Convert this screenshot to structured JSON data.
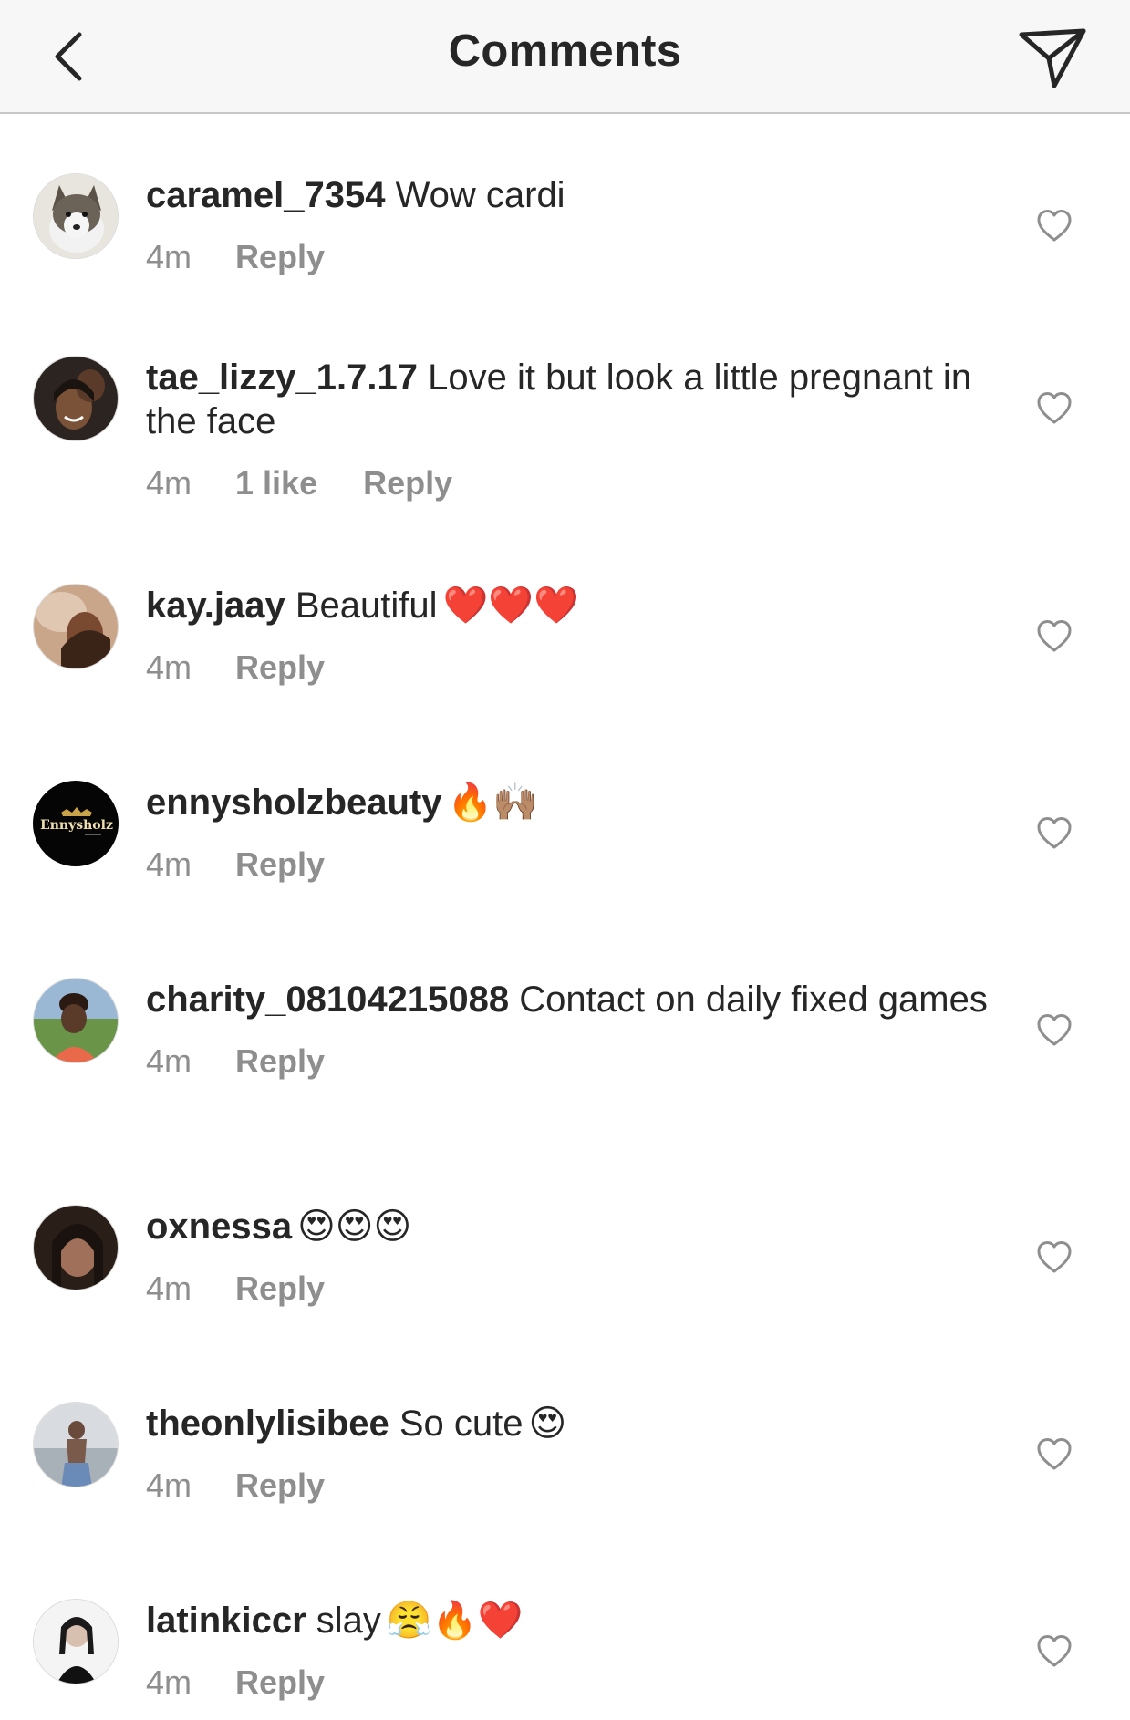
{
  "header": {
    "title": "Comments"
  },
  "icons": {
    "back": "chevron-left-icon",
    "share": "paper-plane-icon",
    "like": "heart-outline-icon"
  },
  "colors": {
    "text": "#262626",
    "meta": "#8e8e8e",
    "header_bg": "#f7f7f7",
    "divider": "#c8c8c8",
    "heart_red": "#e0283a"
  },
  "comments": [
    {
      "username": "caramel_7354",
      "text": "Wow cardi",
      "emoji": "",
      "time": "4m",
      "likes": "",
      "reply": "Reply"
    },
    {
      "username": "tae_lizzy_1.7.17",
      "text": "Love it but look a little pregnant in the face",
      "emoji": "",
      "time": "4m",
      "likes": "1 like",
      "reply": "Reply"
    },
    {
      "username": "kay.jaay",
      "text": "Beautiful",
      "emoji": "❤️❤️❤️",
      "time": "4m",
      "likes": "",
      "reply": "Reply"
    },
    {
      "username": "ennysholzbeauty",
      "text": "",
      "emoji": "🔥🙌🏽",
      "time": "4m",
      "likes": "",
      "reply": "Reply",
      "avatar_text": "Ennysholz"
    },
    {
      "username": "charity_08104215088",
      "text": "Contact on daily fixed games",
      "emoji": "",
      "time": "4m",
      "likes": "",
      "reply": "Reply"
    },
    {
      "username": "oxnessa",
      "text": "",
      "emoji": "😍😍😍",
      "time": "4m",
      "likes": "",
      "reply": "Reply"
    },
    {
      "username": "theonlylisibee",
      "text": "So cute",
      "emoji": "😍",
      "time": "4m",
      "likes": "",
      "reply": "Reply"
    },
    {
      "username": "latinkiccr",
      "text": "slay",
      "emoji": "😤🔥❤️",
      "time": "4m",
      "likes": "",
      "reply": "Reply"
    }
  ]
}
